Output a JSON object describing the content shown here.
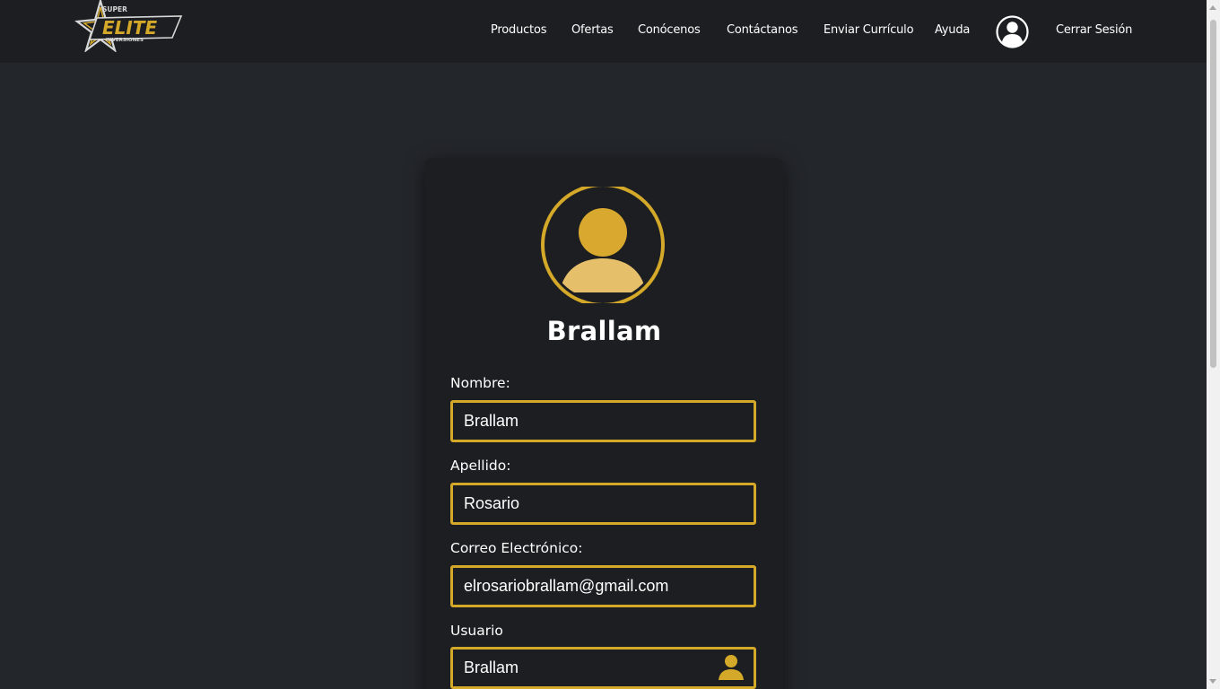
{
  "header": {
    "logo": {
      "small_text": "SUPER",
      "main_text": "ELITE",
      "sub_text": "INVERSIONES"
    },
    "nav": [
      {
        "label": "Productos"
      },
      {
        "label": "Ofertas"
      },
      {
        "label": "Conócenos"
      },
      {
        "label": "Contáctanos"
      },
      {
        "label": "Enviar Currículo"
      },
      {
        "label": "Ayuda"
      }
    ],
    "account_icon": "account-circle-icon",
    "logout_label": "Cerrar Sesión"
  },
  "profile": {
    "avatar_icon": "user-avatar-icon",
    "name": "Brallam",
    "fields": [
      {
        "label": "Nombre:",
        "value": "Brallam"
      },
      {
        "label": "Apellido:",
        "value": "Rosario"
      },
      {
        "label": "Correo Electrónico:",
        "value": "elrosariobrallam@gmail.com"
      },
      {
        "label": "Usuario",
        "value": "Brallam",
        "icon": "user-icon"
      }
    ]
  },
  "colors": {
    "accent": "#d4a828",
    "background": "#23262b",
    "header": "#1c1e21",
    "card": "#1c1e21"
  }
}
